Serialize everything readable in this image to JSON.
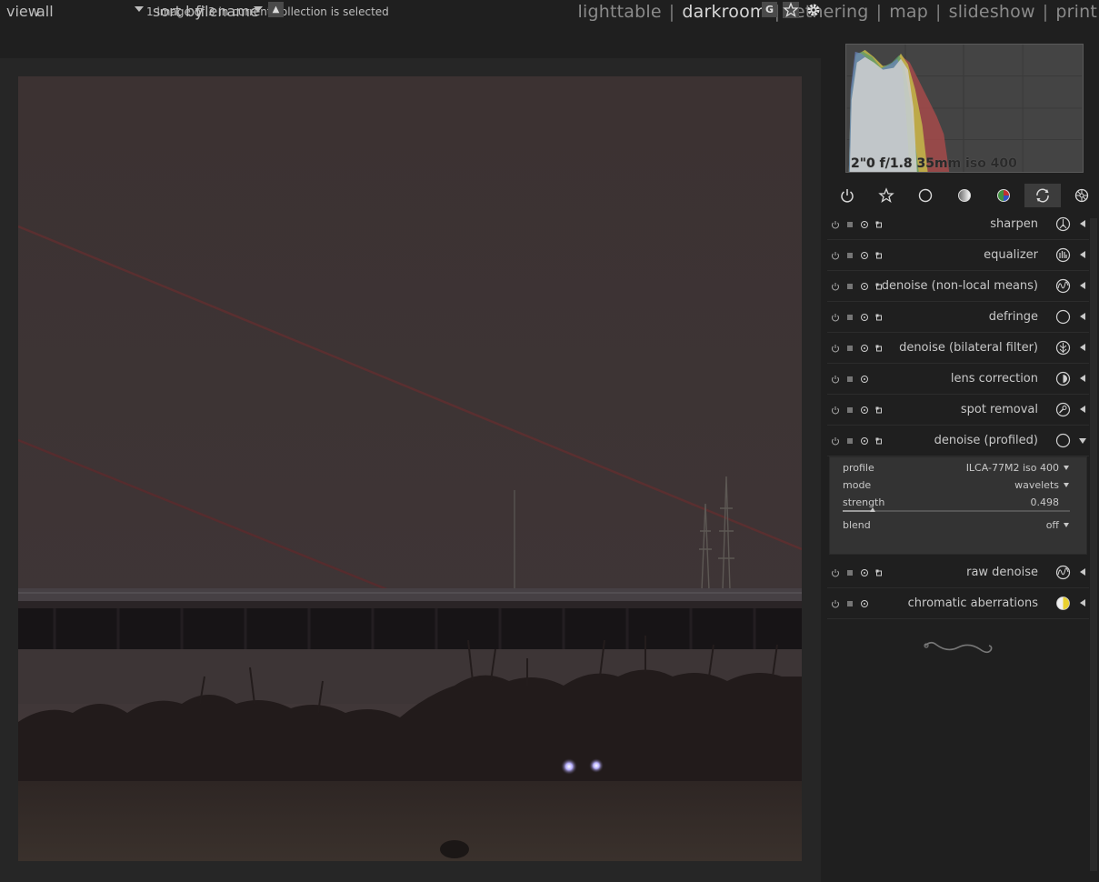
{
  "app": {
    "status": "1 image of 3 in current collection is selected",
    "views": [
      "lighttable",
      "darkroom",
      "tethering",
      "map",
      "slideshow",
      "print"
    ],
    "active_view": "darkroom"
  },
  "filterbar": {
    "view_label": "view",
    "view_value": "all",
    "sort_label": "sort by",
    "sort_value": "filename",
    "sort_dir_glyph": "▲",
    "g_label": "G",
    "star_icon": "star-icon",
    "gear_icon": "gear-icon"
  },
  "histogram": {
    "exif": "2\"0 f/1.8 35mm iso 400"
  },
  "module_groups": [
    "power-icon",
    "star-icon",
    "circle-icon",
    "tone-icon",
    "color-icon",
    "correction-icon",
    "effect-icon"
  ],
  "active_group": "correction-icon",
  "modules": [
    {
      "label": "sharpen",
      "icon": "sharpen-icon",
      "expanded": false,
      "has_extra": true
    },
    {
      "label": "equalizer",
      "icon": "equalizer-icon",
      "expanded": false,
      "has_extra": true
    },
    {
      "label": "denoise (non-local means)",
      "icon": "wave-icon",
      "expanded": false,
      "has_extra": true
    },
    {
      "label": "defringe",
      "icon": "circle-icon",
      "expanded": false,
      "has_extra": true
    },
    {
      "label": "denoise (bilateral filter)",
      "icon": "bilateral-icon",
      "expanded": false,
      "has_extra": true
    },
    {
      "label": "lens correction",
      "icon": "lens-icon",
      "expanded": false,
      "has_extra": false
    },
    {
      "label": "spot removal",
      "icon": "spot-icon",
      "expanded": false,
      "has_extra": true
    },
    {
      "label": "denoise (profiled)",
      "icon": "circle-icon",
      "expanded": true,
      "has_extra": true
    },
    {
      "label": "raw denoise",
      "icon": "wave-icon",
      "expanded": false,
      "has_extra": true
    },
    {
      "label": "chromatic aberrations",
      "icon": "chroma-icon",
      "expanded": false,
      "has_extra": false
    }
  ],
  "denoise_profiled": {
    "profile_label": "profile",
    "profile_value": "ILCA-77M2 iso 400",
    "mode_label": "mode",
    "mode_value": "wavelets",
    "strength_label": "strength",
    "strength_value": "0.498",
    "strength_fraction": 0.13,
    "blend_label": "blend",
    "blend_value": "off"
  },
  "colors": {
    "bg": "#1f1f1f",
    "panel": "#333333",
    "text": "#c8c8c8",
    "active_view": "#d8d8d8"
  }
}
